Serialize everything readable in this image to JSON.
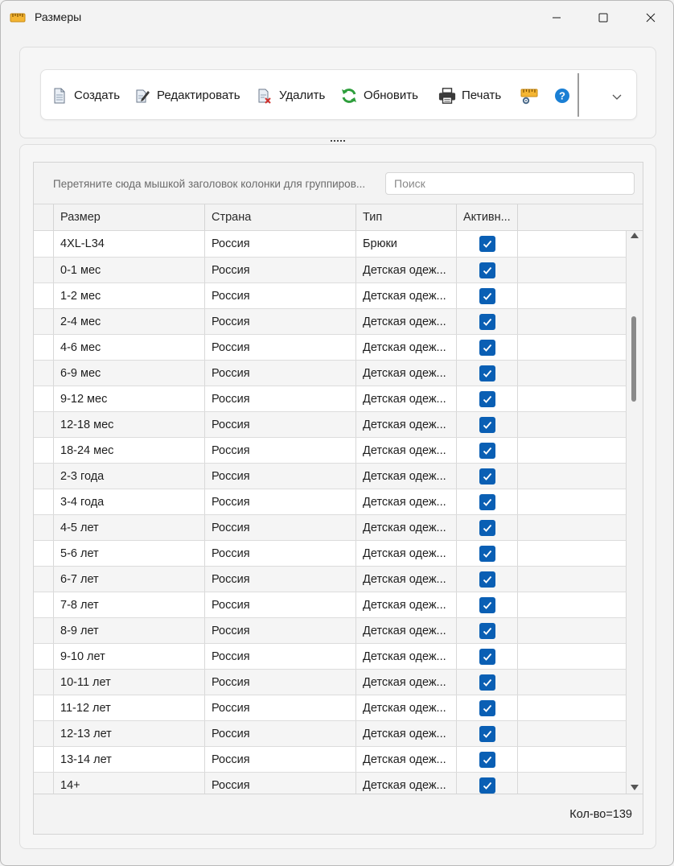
{
  "window": {
    "title": "Размеры",
    "icon": "ruler-icon"
  },
  "toolbar": {
    "create_label": "Создать",
    "edit_label": "Редактировать",
    "delete_label": "Удалить",
    "refresh_label": "Обновить",
    "print_label": "Печать",
    "settings_icon": "ruler-settings-icon",
    "help_icon": "help-icon",
    "expand_icon": "chevron-down-icon"
  },
  "grid": {
    "group_hint": "Перетяните сюда мышкой заголовок колонки для группиров...",
    "search_placeholder": "Поиск",
    "columns": [
      "Размер",
      "Страна",
      "Тип",
      "Активн..."
    ],
    "rows": [
      {
        "size": "4XL-L34",
        "country": "Россия",
        "type": "Брюки",
        "active": true
      },
      {
        "size": "0-1 мес",
        "country": "Россия",
        "type": "Детская одеж...",
        "active": true
      },
      {
        "size": "1-2 мес",
        "country": "Россия",
        "type": "Детская одеж...",
        "active": true
      },
      {
        "size": "2-4 мес",
        "country": "Россия",
        "type": "Детская одеж...",
        "active": true
      },
      {
        "size": "4-6 мес",
        "country": "Россия",
        "type": "Детская одеж...",
        "active": true
      },
      {
        "size": "6-9 мес",
        "country": "Россия",
        "type": "Детская одеж...",
        "active": true
      },
      {
        "size": "9-12 мес",
        "country": "Россия",
        "type": "Детская одеж...",
        "active": true
      },
      {
        "size": "12-18 мес",
        "country": "Россия",
        "type": "Детская одеж...",
        "active": true
      },
      {
        "size": "18-24 мес",
        "country": "Россия",
        "type": "Детская одеж...",
        "active": true
      },
      {
        "size": "2-3 года",
        "country": "Россия",
        "type": "Детская одеж...",
        "active": true
      },
      {
        "size": "3-4 года",
        "country": "Россия",
        "type": "Детская одеж...",
        "active": true
      },
      {
        "size": "4-5 лет",
        "country": "Россия",
        "type": "Детская одеж...",
        "active": true
      },
      {
        "size": "5-6 лет",
        "country": "Россия",
        "type": "Детская одеж...",
        "active": true
      },
      {
        "size": "6-7 лет",
        "country": "Россия",
        "type": "Детская одеж...",
        "active": true
      },
      {
        "size": "7-8 лет",
        "country": "Россия",
        "type": "Детская одеж...",
        "active": true
      },
      {
        "size": "8-9 лет",
        "country": "Россия",
        "type": "Детская одеж...",
        "active": true
      },
      {
        "size": "9-10 лет",
        "country": "Россия",
        "type": "Детская одеж...",
        "active": true
      },
      {
        "size": "10-11 лет",
        "country": "Россия",
        "type": "Детская одеж...",
        "active": true
      },
      {
        "size": "11-12 лет",
        "country": "Россия",
        "type": "Детская одеж...",
        "active": true
      },
      {
        "size": "12-13 лет",
        "country": "Россия",
        "type": "Детская одеж...",
        "active": true
      },
      {
        "size": "13-14 лет",
        "country": "Россия",
        "type": "Детская одеж...",
        "active": true
      },
      {
        "size": "14+",
        "country": "Россия",
        "type": "Детская одеж...",
        "active": true
      }
    ],
    "count_label": "Кол-во=139"
  },
  "colors": {
    "accent": "#0a5fb4",
    "refresh": "#2e9e3c",
    "help": "#1a7fd4",
    "ruler": "#e6a020"
  }
}
